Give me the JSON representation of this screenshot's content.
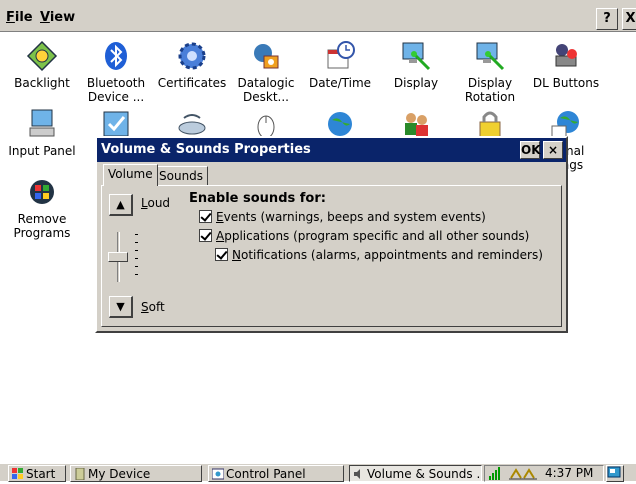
{
  "menubar": {
    "file": {
      "first": "F",
      "rest": "ile"
    },
    "view": {
      "first": "V",
      "rest": "iew"
    },
    "help_label": "?",
    "close_label": "X"
  },
  "control_panel": {
    "items": [
      {
        "line1": "Backlight",
        "line2": "",
        "icon": "backlight-icon"
      },
      {
        "line1": "Bluetooth",
        "line2": "Device ...",
        "icon": "bluetooth-icon"
      },
      {
        "line1": "Certificates",
        "line2": "",
        "icon": "certificates-icon"
      },
      {
        "line1": "Datalogic",
        "line2": "Deskt...",
        "icon": "datalogic-desktop-icon"
      },
      {
        "line1": "Date/Time",
        "line2": "",
        "icon": "date-time-icon"
      },
      {
        "line1": "Display",
        "line2": "",
        "icon": "display-icon"
      },
      {
        "line1": "Display",
        "line2": "Rotation",
        "icon": "display-rotation-icon"
      },
      {
        "line1": "DL Buttons",
        "line2": "",
        "icon": "dl-buttons-icon"
      },
      {
        "line1": "Input Panel",
        "line2": "",
        "icon": "input-panel-icon"
      },
      {
        "line1": "",
        "line2": "",
        "icon": "check-icon"
      },
      {
        "line1": "",
        "line2": "",
        "icon": "keyboard-icon"
      },
      {
        "line1": "",
        "line2": "",
        "icon": "mouse-icon"
      },
      {
        "line1": "",
        "line2": "",
        "icon": "network-icon"
      },
      {
        "line1": "",
        "line2": "",
        "icon": "owner-icon"
      },
      {
        "line1": "",
        "line2": "",
        "icon": "password-icon"
      },
      {
        "line1": "gional",
        "line2": "ttings",
        "icon": "regional-settings-icon"
      },
      {
        "line1": "Remove",
        "line2": "Programs",
        "icon": "remove-programs-icon"
      }
    ]
  },
  "dialog": {
    "title": "Volume & Sounds Properties",
    "ok_label": "OK",
    "close_label": "×",
    "tabs": [
      {
        "label": "Volume",
        "active": true
      },
      {
        "label": "Sounds",
        "active": false
      }
    ],
    "volume": {
      "loud": {
        "first": "L",
        "rest": "oud"
      },
      "soft": {
        "first": "S",
        "rest": "oft"
      },
      "level_fraction": 0.5
    },
    "enable_heading": "Enable sounds for:",
    "checkboxes": [
      {
        "first": "E",
        "rest": "vents (warnings, beeps and system events)",
        "checked": true
      },
      {
        "first": "A",
        "rest": "pplications (program specific and all other sounds)",
        "checked": true
      },
      {
        "first": "N",
        "rest": "otifications (alarms, appointments and reminders)",
        "checked": true
      }
    ]
  },
  "taskbar": {
    "start": "Start",
    "tasks": [
      "My Device",
      "Control Panel",
      "Volume & Sounds ..."
    ],
    "time": "4:37 PM"
  },
  "colors": {
    "title_bar": "#0a246a",
    "face": "#d4d0c8"
  }
}
